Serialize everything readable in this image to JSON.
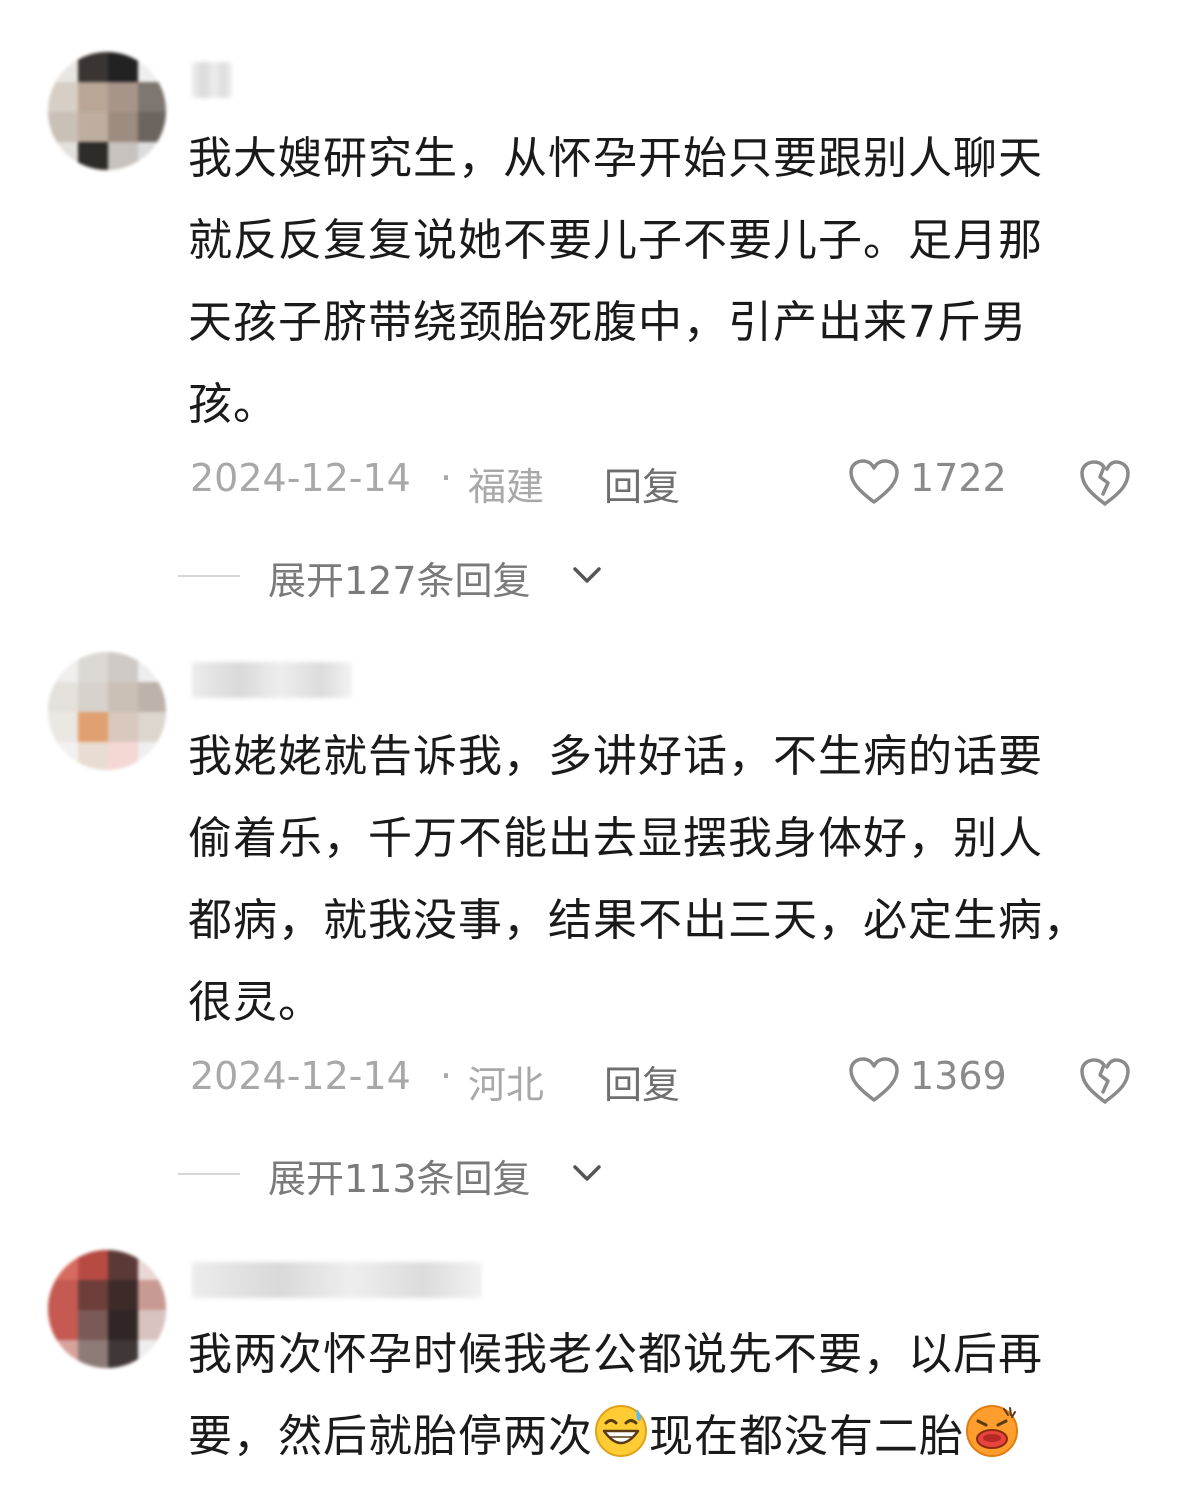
{
  "comments": [
    {
      "text_lines": [
        "我大嫂研究生，从怀孕开始只要跟别人聊天",
        "就反反复复说她不要儿子不要儿子。足月那",
        "天孩子脐带绕颈胎死腹中，引产出来7斤男",
        "孩。"
      ],
      "date": "2024-12-14",
      "separator": "·",
      "location": "福建",
      "reply_label": "回复",
      "likes": "1722",
      "expand_label": "展开127条回复"
    },
    {
      "text_lines": [
        "我姥姥就告诉我，多讲好话，不生病的话要",
        "偷着乐，千万不能出去显摆我身体好，别人",
        "都病，就我没事，结果不出三天，必定生病，",
        "很灵。"
      ],
      "date": "2024-12-14",
      "separator": "·",
      "location": "河北",
      "reply_label": "回复",
      "likes": "1369",
      "expand_label": "展开113条回复"
    },
    {
      "text_line1": "我两次怀孕时候我老公都说先不要，以后再",
      "text_line2_a": "要，然后就胎停两次",
      "text_line2_b": "现在都没有二胎",
      "emoji_1": "grinning-sweat-emoji",
      "emoji_2": "face-with-open-mouth-emoji"
    }
  ],
  "colors": {
    "text": "#1a1a1a",
    "meta": "#a8a8a8",
    "expand": "#7a7a7a",
    "background": "#ffffff"
  },
  "icons": {
    "like": "heart-outline-icon",
    "dislike": "broken-heart-icon",
    "expand": "chevron-down-icon"
  }
}
